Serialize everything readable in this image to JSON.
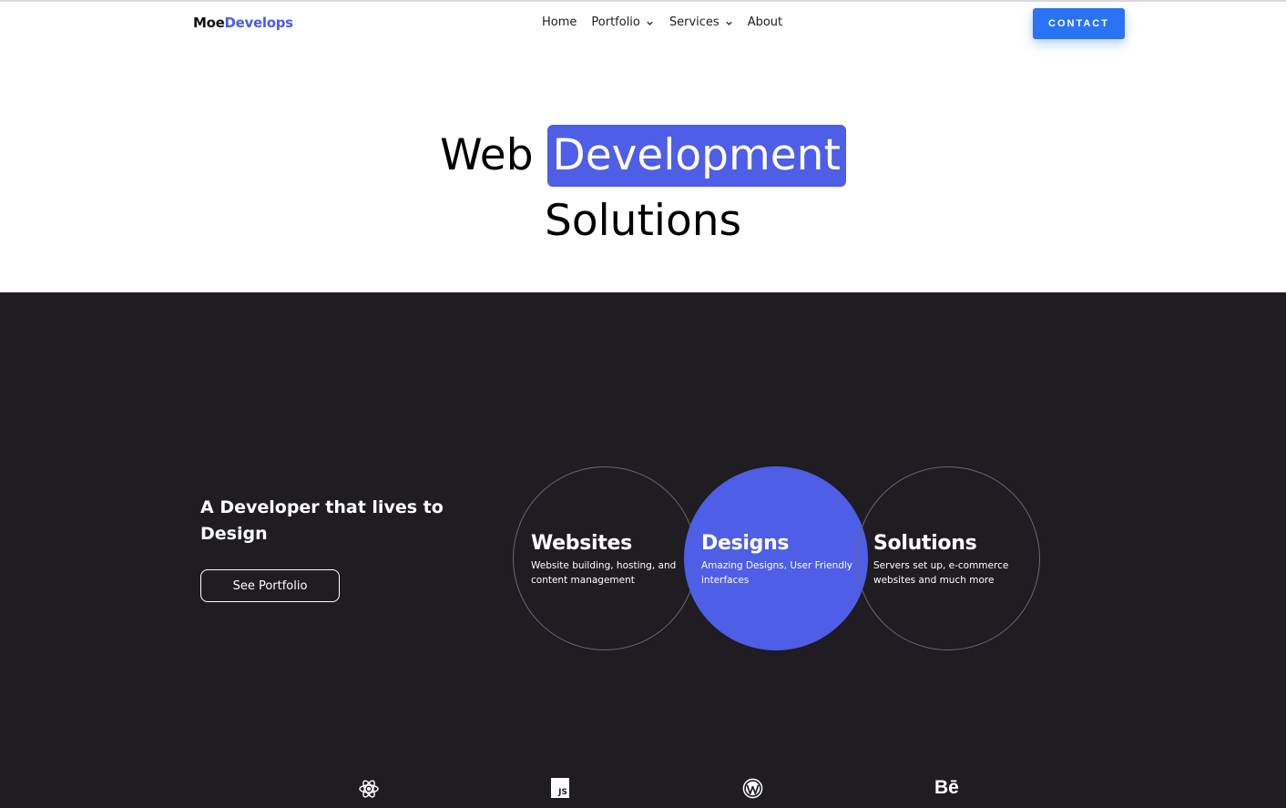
{
  "header": {
    "logo_part1": "Moe",
    "logo_part2": "Develops",
    "nav": {
      "home": "Home",
      "portfolio": "Portfolio",
      "services": "Services",
      "about": "About"
    },
    "contact_label": "CONTACT"
  },
  "hero": {
    "word1": "Web",
    "highlight": "Development",
    "line2": "Solutions"
  },
  "about": {
    "tagline": "A Developer that lives to Design",
    "button_label": "See Portfolio"
  },
  "services": [
    {
      "title": "Websites",
      "description": "Website building, hosting, and content management"
    },
    {
      "title": "Designs",
      "description": "Amazing Designs, User Friendly interfaces"
    },
    {
      "title": "Solutions",
      "description": "Servers set up, e-commerce websites and much more"
    }
  ],
  "tech_icons": [
    "react-icon",
    "javascript-icon",
    "wordpress-icon",
    "behance-icon"
  ],
  "tech": {
    "js_label": "JS",
    "behance_label": "Bē"
  },
  "colors": {
    "accent": "#4e5ee6",
    "contact_button": "#2a73f5",
    "dark_background": "#1f1c22",
    "text": "#000000"
  }
}
